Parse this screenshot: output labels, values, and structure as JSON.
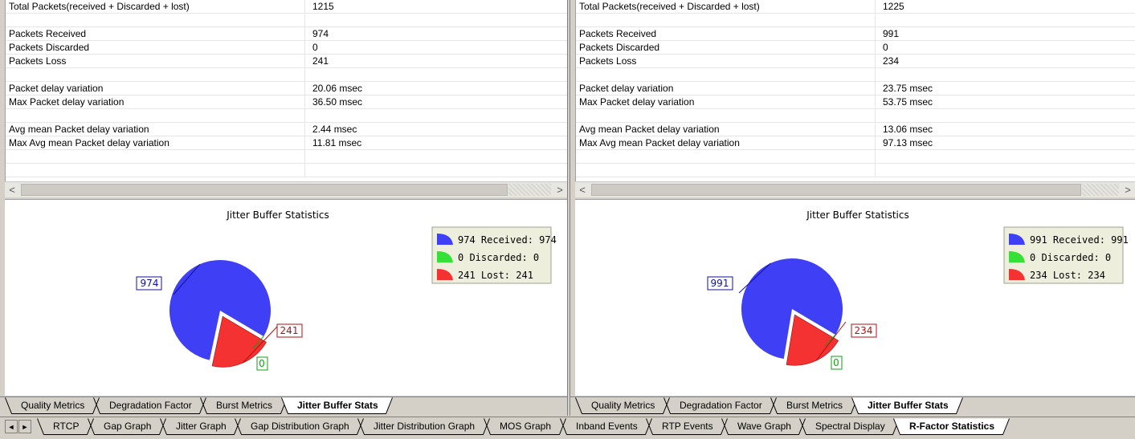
{
  "left_panel": {
    "rows": [
      {
        "label": "Total Packets(received + Discarded + lost)",
        "value": "1215"
      },
      {
        "label": "",
        "value": ""
      },
      {
        "label": "Packets Received",
        "value": "974"
      },
      {
        "label": "Packets Discarded",
        "value": "0"
      },
      {
        "label": "Packets Loss",
        "value": "241"
      },
      {
        "label": "",
        "value": ""
      },
      {
        "label": "Packet delay variation",
        "value": "20.06 msec"
      },
      {
        "label": "Max Packet delay variation",
        "value": "36.50 msec"
      },
      {
        "label": "",
        "value": ""
      },
      {
        "label": "Avg mean Packet delay variation",
        "value": "2.44 msec"
      },
      {
        "label": "Max Avg mean Packet delay variation",
        "value": "11.81 msec"
      },
      {
        "label": "",
        "value": ""
      },
      {
        "label": "",
        "value": ""
      }
    ],
    "scroll_left_icon": "<",
    "scroll_right_icon": ">",
    "tabs": [
      {
        "label": "Quality Metrics",
        "active": false
      },
      {
        "label": "Degradation Factor",
        "active": false
      },
      {
        "label": "Burst Metrics",
        "active": false
      },
      {
        "label": "Jitter Buffer Stats",
        "active": true
      }
    ]
  },
  "right_panel": {
    "rows": [
      {
        "label": "Total Packets(received + Discarded + lost)",
        "value": "1225"
      },
      {
        "label": "",
        "value": ""
      },
      {
        "label": "Packets Received",
        "value": "991"
      },
      {
        "label": "Packets Discarded",
        "value": "0"
      },
      {
        "label": "Packets Loss",
        "value": "234"
      },
      {
        "label": "",
        "value": ""
      },
      {
        "label": "Packet delay variation",
        "value": "23.75 msec"
      },
      {
        "label": "Max Packet delay variation",
        "value": "53.75 msec"
      },
      {
        "label": "",
        "value": ""
      },
      {
        "label": "Avg mean Packet delay variation",
        "value": "13.06 msec"
      },
      {
        "label": "Max Avg mean Packet delay variation",
        "value": "97.13 msec"
      },
      {
        "label": "",
        "value": ""
      },
      {
        "label": "",
        "value": ""
      }
    ],
    "scroll_left_icon": "<",
    "scroll_right_icon": ">",
    "tabs": [
      {
        "label": "Quality Metrics",
        "active": false
      },
      {
        "label": "Degradation Factor",
        "active": false
      },
      {
        "label": "Burst Metrics",
        "active": false
      },
      {
        "label": "Jitter Buffer Stats",
        "active": true
      }
    ]
  },
  "chart_data": [
    {
      "type": "pie",
      "title": "Jitter Buffer Statistics",
      "categories": [
        "Received",
        "Discarded",
        "Lost"
      ],
      "values": [
        974,
        0,
        241
      ],
      "data_labels": [
        "974",
        "0",
        "241"
      ],
      "legend": [
        "974 Received: 974",
        "0 Discarded: 0",
        "241 Lost: 241"
      ],
      "colors": [
        "#3f3ff5",
        "#36e036",
        "#f53232"
      ],
      "label_colors": [
        "#1010a0",
        "#10a010",
        "#b01010"
      ],
      "legend_placement": "top-right"
    },
    {
      "type": "pie",
      "title": "Jitter Buffer Statistics",
      "categories": [
        "Received",
        "Discarded",
        "Lost"
      ],
      "values": [
        991,
        0,
        234
      ],
      "data_labels": [
        "991",
        "0",
        "234"
      ],
      "legend": [
        "991 Received: 991",
        "0 Discarded: 0",
        "234 Lost: 234"
      ],
      "colors": [
        "#3f3ff5",
        "#36e036",
        "#f53232"
      ],
      "label_colors": [
        "#1010a0",
        "#10a010",
        "#b01010"
      ],
      "legend_placement": "top-right"
    }
  ],
  "bottom_tabs": {
    "nav_prev_icon": "◄",
    "nav_next_icon": "►",
    "items": [
      {
        "label": "RTCP",
        "active": false
      },
      {
        "label": "Gap Graph",
        "active": false
      },
      {
        "label": "Jitter Graph",
        "active": false
      },
      {
        "label": "Gap Distribution Graph",
        "active": false
      },
      {
        "label": "Jitter Distribution Graph",
        "active": false
      },
      {
        "label": "MOS Graph",
        "active": false
      },
      {
        "label": "Inband Events",
        "active": false
      },
      {
        "label": "RTP Events",
        "active": false
      },
      {
        "label": "Wave Graph",
        "active": false
      },
      {
        "label": "Spectral Display",
        "active": false
      },
      {
        "label": "R-Factor Statistics",
        "active": true
      }
    ]
  }
}
